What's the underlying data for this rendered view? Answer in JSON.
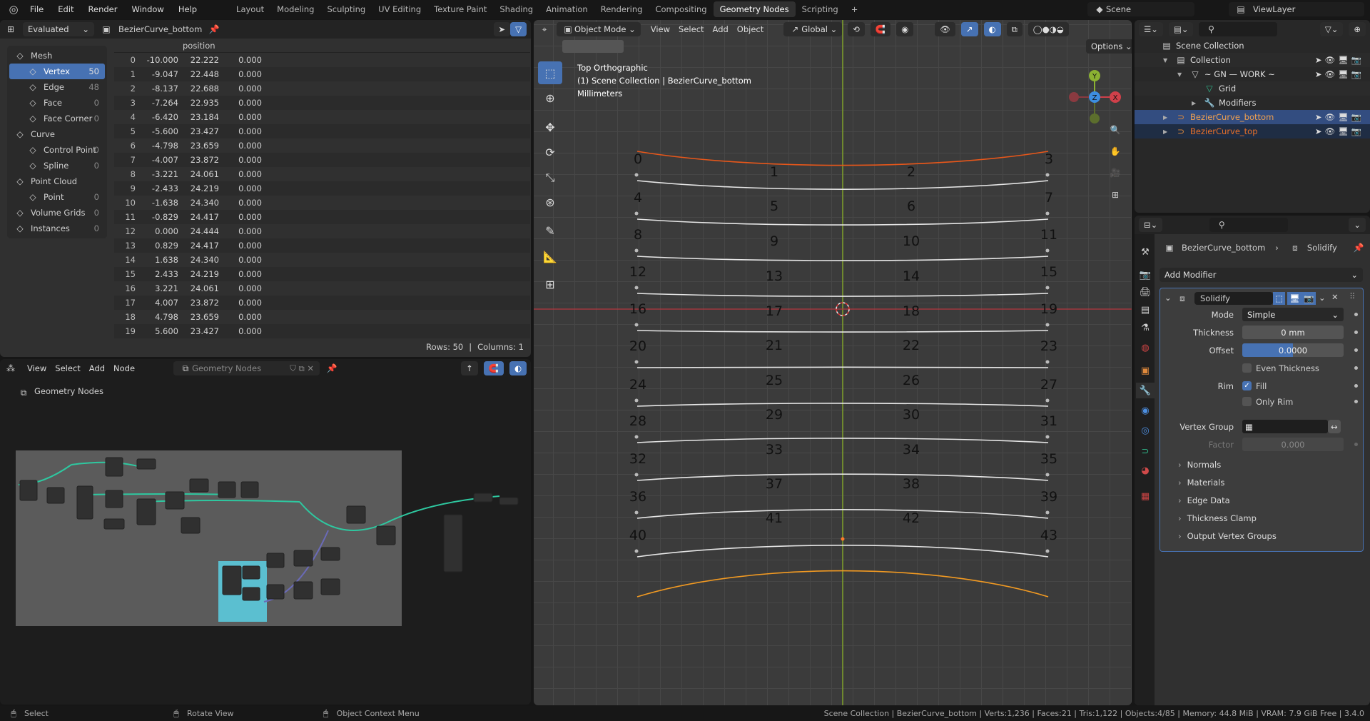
{
  "topbar": {
    "menus": [
      "File",
      "Edit",
      "Render",
      "Window",
      "Help"
    ],
    "workspaces": [
      "Layout",
      "Modeling",
      "Sculpting",
      "UV Editing",
      "Texture Paint",
      "Shading",
      "Animation",
      "Rendering",
      "Compositing",
      "Geometry Nodes",
      "Scripting"
    ],
    "active_workspace": "Geometry Nodes",
    "add": "+",
    "scene": "Scene",
    "view_layer": "ViewLayer"
  },
  "spreadsheet": {
    "mode": "Evaluated",
    "object": "BezierCurve_bottom",
    "column_header": "position",
    "domains": [
      {
        "label": "Mesh",
        "count": "",
        "level": 0,
        "icon": "mesh-icon"
      },
      {
        "label": "Vertex",
        "count": "50",
        "level": 1,
        "selected": true,
        "icon": "vertex-icon"
      },
      {
        "label": "Edge",
        "count": "48",
        "level": 1,
        "icon": "edge-icon"
      },
      {
        "label": "Face",
        "count": "0",
        "level": 1,
        "icon": "face-icon"
      },
      {
        "label": "Face Corner",
        "count": "0",
        "level": 1,
        "icon": "face-corner-icon"
      },
      {
        "label": "Curve",
        "count": "",
        "level": 0,
        "icon": "curve-icon"
      },
      {
        "label": "Control Point",
        "count": "0",
        "level": 1,
        "icon": "control-point-icon"
      },
      {
        "label": "Spline",
        "count": "0",
        "level": 1,
        "icon": "spline-icon"
      },
      {
        "label": "Point Cloud",
        "count": "",
        "level": 0,
        "icon": "point-cloud-icon"
      },
      {
        "label": "Point",
        "count": "0",
        "level": 1,
        "icon": "point-icon"
      },
      {
        "label": "Volume Grids",
        "count": "0",
        "level": 0,
        "icon": "volume-icon"
      },
      {
        "label": "Instances",
        "count": "0",
        "level": 0,
        "icon": "instances-icon"
      }
    ],
    "rows": [
      [
        "0",
        "-10.000",
        "22.222",
        "0.000"
      ],
      [
        "1",
        "-9.047",
        "22.448",
        "0.000"
      ],
      [
        "2",
        "-8.137",
        "22.688",
        "0.000"
      ],
      [
        "3",
        "-7.264",
        "22.935",
        "0.000"
      ],
      [
        "4",
        "-6.420",
        "23.184",
        "0.000"
      ],
      [
        "5",
        "-5.600",
        "23.427",
        "0.000"
      ],
      [
        "6",
        "-4.798",
        "23.659",
        "0.000"
      ],
      [
        "7",
        "-4.007",
        "23.872",
        "0.000"
      ],
      [
        "8",
        "-3.221",
        "24.061",
        "0.000"
      ],
      [
        "9",
        "-2.433",
        "24.219",
        "0.000"
      ],
      [
        "10",
        "-1.638",
        "24.340",
        "0.000"
      ],
      [
        "11",
        "-0.829",
        "24.417",
        "0.000"
      ],
      [
        "12",
        "0.000",
        "24.444",
        "0.000"
      ],
      [
        "13",
        "0.829",
        "24.417",
        "0.000"
      ],
      [
        "14",
        "1.638",
        "24.340",
        "0.000"
      ],
      [
        "15",
        "2.433",
        "24.219",
        "0.000"
      ],
      [
        "16",
        "3.221",
        "24.061",
        "0.000"
      ],
      [
        "17",
        "4.007",
        "23.872",
        "0.000"
      ],
      [
        "18",
        "4.798",
        "23.659",
        "0.000"
      ],
      [
        "19",
        "5.600",
        "23.427",
        "0.000"
      ]
    ],
    "footer_rows": "Rows: 50",
    "footer_sep": "|",
    "footer_cols": "Columns: 1"
  },
  "node_editor": {
    "menus": [
      "View",
      "Select",
      "Add",
      "Node"
    ],
    "node_tree": "Geometry Nodes",
    "breadcrumb": "Geometry Nodes"
  },
  "viewport": {
    "mode": "Object Mode",
    "menus": [
      "View",
      "Select",
      "Add",
      "Object"
    ],
    "orientation": "Global",
    "options": "Options",
    "overlay": [
      "Top Orthographic",
      "(1) Scene Collection | BezierCurve_bottom",
      "Millimeters"
    ],
    "gizmo": {
      "y": "Y",
      "z": "Z",
      "x": "X"
    },
    "vertex_labels": [
      [
        "0",
        "1",
        "2",
        "3"
      ],
      [
        "4",
        "5",
        "6",
        "7"
      ],
      [
        "8",
        "9",
        "10",
        "11"
      ],
      [
        "12",
        "13",
        "14",
        "15"
      ],
      [
        "16",
        "17",
        "18",
        "19"
      ],
      [
        "20",
        "21",
        "22",
        "23"
      ],
      [
        "24",
        "25",
        "26",
        "27"
      ],
      [
        "28",
        "29",
        "30",
        "31"
      ],
      [
        "32",
        "33",
        "34",
        "35"
      ],
      [
        "36",
        "37",
        "38",
        "39"
      ],
      [
        "40",
        "41",
        "42",
        "43"
      ]
    ],
    "colors": {
      "curve_top": "#e8571a",
      "curve_bottom": "#f29a22",
      "mesh_lines": "#e6e6e6",
      "y_axis": "#7fa12a",
      "x_axis": "#b5363f"
    }
  },
  "outliner": {
    "items": [
      {
        "label": "Scene Collection",
        "depth": 0
      },
      {
        "label": "Collection",
        "depth": 1
      },
      {
        "label": "~ GN — WORK ~",
        "depth": 2
      },
      {
        "label": "Grid",
        "depth": 3
      },
      {
        "label": "Modifiers",
        "depth": 3
      },
      {
        "label": "BezierCurve_bottom",
        "depth": 1,
        "selected": true
      },
      {
        "label": "BezierCurve_top",
        "depth": 1
      }
    ]
  },
  "properties": {
    "object": "BezierCurve_bottom",
    "modifier": "Solidify",
    "add_modifier": "Add Modifier",
    "panel_name": "Solidify",
    "mode_label": "Mode",
    "mode_value": "Simple",
    "thickness_label": "Thickness",
    "thickness_value": "0 mm",
    "offset_label": "Offset",
    "offset_value": "0.0000",
    "offset_fraction": 0.5,
    "even_thickness": "Even Thickness",
    "rim_label": "Rim",
    "fill": "Fill",
    "fill_checked": true,
    "only_rim": "Only Rim",
    "vertex_group_label": "Vertex Group",
    "factor_label": "Factor",
    "factor_value": "0.000",
    "subpanels": [
      "Normals",
      "Materials",
      "Edge Data",
      "Thickness Clamp",
      "Output Vertex Groups"
    ]
  },
  "statusbar": {
    "select": "Select",
    "rotate": "Rotate View",
    "context": "Object Context Menu",
    "info": "Scene Collection | BezierCurve_bottom | Verts:1,236 | Faces:21 | Tris:1,122 | Objects:4/85 | Memory: 44.8 MiB | VRAM: 7.9 GiB Free | 3.4.0"
  }
}
